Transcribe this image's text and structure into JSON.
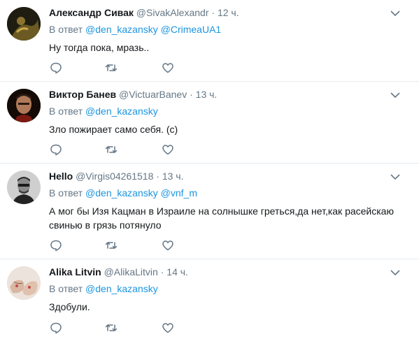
{
  "reply_prefix": "В ответ",
  "colors": {
    "link": "#1b95e0",
    "muted": "#657786",
    "text": "#14171a",
    "divider": "#e6ecf0"
  },
  "icons": {
    "more": "chevron-down-icon",
    "reply": "reply-bubble-icon",
    "retweet": "retweet-icon",
    "like": "heart-icon"
  },
  "tweets": [
    {
      "name": "Александр Сивак",
      "handle": "@SivakAlexandr",
      "separator": "·",
      "time": "12 ч.",
      "mentions": [
        "@den_kazansky",
        "@CrimeaUA1"
      ],
      "text": "Ну тогда пока, мразь.."
    },
    {
      "name": "Виктор Банев",
      "handle": "@VictuarBanev",
      "separator": "·",
      "time": "13 ч.",
      "mentions": [
        "@den_kazansky"
      ],
      "text": "Зло пожирает само себя. (с)"
    },
    {
      "name": "Hello",
      "handle": "@Virgis04261518",
      "separator": "·",
      "time": "13 ч.",
      "mentions": [
        "@den_kazansky",
        "@vnf_m"
      ],
      "text": "А мог бы Изя Кацман в Израиле на солнышке греться,да нет,как расейскаю свинью в грязь потянуло"
    },
    {
      "name": "Alika Litvin",
      "handle": "@AlikaLitvin",
      "separator": "·",
      "time": "14 ч.",
      "mentions": [
        "@den_kazansky"
      ],
      "text": "Здобули."
    }
  ]
}
